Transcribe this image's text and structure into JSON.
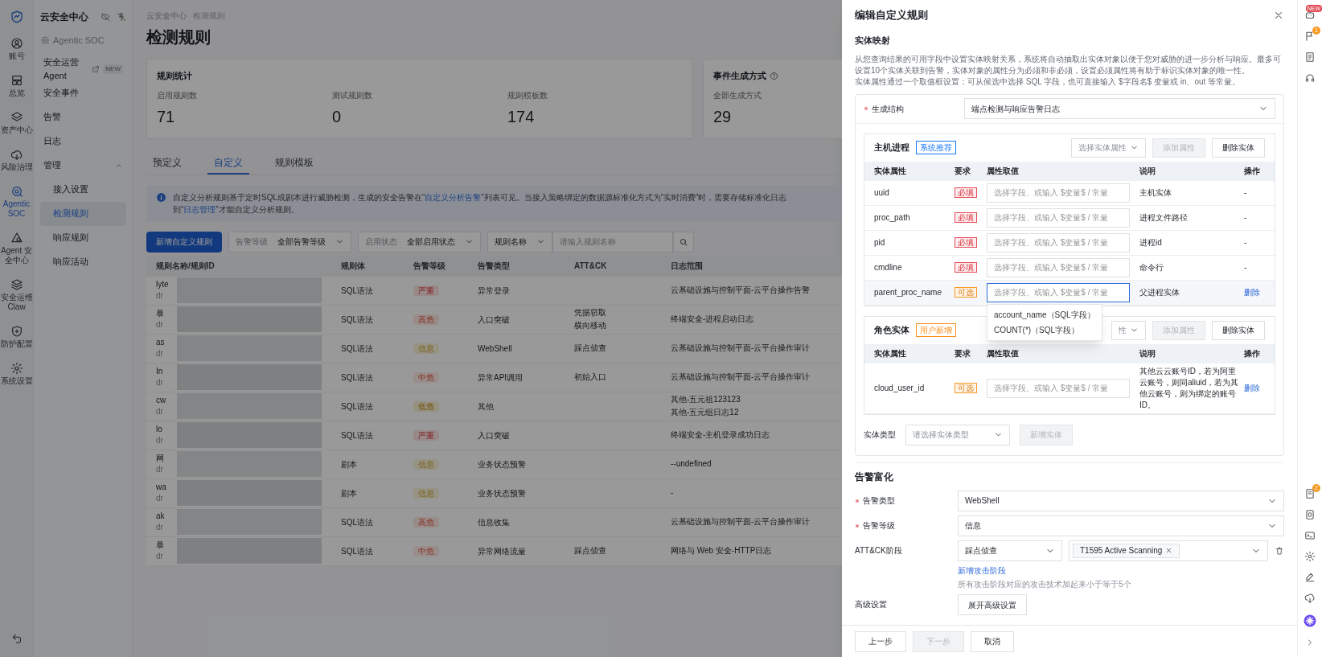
{
  "nav_rail": {
    "items": [
      {
        "label": "账号",
        "selected": false
      },
      {
        "label": "总览",
        "selected": false
      },
      {
        "label": "资产中心",
        "selected": false
      },
      {
        "label": "风险治理",
        "selected": false
      },
      {
        "label": "Agentic SOC",
        "selected": true
      },
      {
        "label": "Agent 安全中心",
        "selected": false
      },
      {
        "label": "安全运维 Claw",
        "selected": false
      },
      {
        "label": "防护配置",
        "selected": false
      },
      {
        "label": "系统设置",
        "selected": false
      }
    ]
  },
  "sidebar": {
    "title": "云安全中心",
    "product": "Agentic SOC",
    "items": [
      {
        "kind": "item",
        "label": "安全运营 Agent",
        "external": true,
        "badge": "NEW",
        "selected": false
      },
      {
        "kind": "item",
        "label": "安全事件",
        "selected": false
      },
      {
        "kind": "item",
        "label": "告警",
        "selected": false
      },
      {
        "kind": "item",
        "label": "日志",
        "selected": false
      },
      {
        "kind": "group",
        "label": "管理",
        "expanded": true,
        "children": [
          {
            "label": "接入设置",
            "selected": false
          },
          {
            "label": "检测规则",
            "selected": true
          },
          {
            "label": "响应规则",
            "selected": false
          },
          {
            "label": "响应活动",
            "selected": false
          }
        ]
      }
    ]
  },
  "main": {
    "breadcrumb": [
      "云安全中心",
      "检测规则"
    ],
    "title": "检测规则",
    "rule_stats": {
      "title": "规则统计",
      "metrics": [
        {
          "label": "启用规则数",
          "value": "71"
        },
        {
          "label": "测试规则数",
          "value": "0"
        },
        {
          "label": "规则模板数",
          "value": "174"
        }
      ]
    },
    "event_stats": {
      "title": "事件生成方式",
      "metrics": [
        {
          "label": "全部生成方式",
          "value": "29"
        }
      ]
    },
    "tabs": [
      {
        "label": "预定义",
        "selected": false
      },
      {
        "label": "自定义",
        "selected": true
      },
      {
        "label": "规则模板",
        "selected": false
      }
    ],
    "notice": [
      {
        "text": "自定义分析规则基于定时SQL或剧本进行威胁检测，生成的安全告警在“",
        "link": false
      },
      {
        "text": "自定义分析告警",
        "link": true
      },
      {
        "text": "”列表可见。当接入策略绑定的数据源标准化方式为“实时消费”时，需要存储标准化日志到“",
        "link": false
      },
      {
        "text": "日志管理",
        "link": true
      },
      {
        "text": "”才能自定义分析规则。",
        "link": false
      }
    ],
    "toolbar": {
      "create_button": "新增自定义规则",
      "filters": [
        {
          "label": "告警等级",
          "value": "全部告警等级"
        },
        {
          "label": "启用状态",
          "value": "全部启用状态"
        }
      ],
      "search": {
        "field": "规则名称",
        "placeholder": "请输入规则名称"
      }
    },
    "table": {
      "columns": [
        "规则名称/规则ID",
        "规则体",
        "告警等级",
        "告警类型",
        "ATT&CK",
        "日志范围"
      ],
      "rows": [
        {
          "name": "lyte",
          "id": "dr",
          "body": "SQL语法",
          "severity": {
            "text": "严重",
            "kind": "critical"
          },
          "type": "异常登录",
          "attack": [],
          "log": [
            "云基础设施与控制平面-云平台操作告警"
          ]
        },
        {
          "name": "暴",
          "id": "dr",
          "body": "SQL语法",
          "severity": {
            "text": "高危",
            "kind": "high"
          },
          "type": "入口突破",
          "attack": [
            "凭据窃取",
            "横向移动"
          ],
          "log": [
            "终端安全-进程启动日志"
          ]
        },
        {
          "name": "as",
          "id": "dr",
          "body": "SQL语法",
          "severity": {
            "text": "信息",
            "kind": "info"
          },
          "type": "WebShell",
          "attack": [
            "踩点侦查"
          ],
          "log": [
            "云基础设施与控制平面-云平台操作审计"
          ]
        },
        {
          "name": "In",
          "id": "dr",
          "body": "SQL语法",
          "severity": {
            "text": "中危",
            "kind": "medium"
          },
          "type": "异常API调用",
          "attack": [
            "初始入口"
          ],
          "log": [
            "云基础设施与控制平面-云平台操作审计"
          ]
        },
        {
          "name": "cw",
          "id": "dr",
          "body": "SQL语法",
          "severity": {
            "text": "低危",
            "kind": "low"
          },
          "type": "其他",
          "attack": [],
          "log": [
            "其他-五元祖123123",
            "其他-五元组日志12"
          ]
        },
        {
          "name": "lo",
          "id": "dr",
          "body": "SQL语法",
          "severity": {
            "text": "严重",
            "kind": "critical"
          },
          "type": "入口突破",
          "attack": [],
          "log": [
            "终端安全-主机登录成功日志"
          ]
        },
        {
          "name": "网",
          "id": "dr",
          "body": "剧本",
          "severity": {
            "text": "信息",
            "kind": "info"
          },
          "type": "业务状态预警",
          "attack": [],
          "log": [
            "--undefined"
          ]
        },
        {
          "name": "wa",
          "id": "dr",
          "body": "剧本",
          "severity": {
            "text": "信息",
            "kind": "info"
          },
          "type": "业务状态预警",
          "attack": [],
          "log": [
            "-"
          ]
        },
        {
          "name": "ak",
          "id": "dr",
          "body": "SQL语法",
          "severity": {
            "text": "高危",
            "kind": "high"
          },
          "type": "信息收集",
          "attack": [],
          "log": [
            "云基础设施与控制平面-云平台操作审计"
          ]
        },
        {
          "name": "暴",
          "id": "dr",
          "body": "SQL语法",
          "severity": {
            "text": "中危",
            "kind": "medium"
          },
          "type": "异常网络流量",
          "attack": [
            "踩点侦查"
          ],
          "log": [
            "网络与 Web 安全-HTTP日志"
          ]
        }
      ]
    }
  },
  "drawer": {
    "title": "编辑自定义规则",
    "entity_mapping": {
      "heading": "实体映射",
      "description": [
        "从您查询结果的可用字段中设置实体映射关系，系统将自动抽取出实体对象以便于您对威胁的进一步分析与响应。最多可设置10个实体关联到告警，实体对象的属性分为必须和非必须，设置必须属性将有助于标识实体对象的唯一性。",
        "实体属性通过一个取值框设置：可从候选中选择 SQL 字段，也可直接输入 $字段名$ 变量或 in、out 等常量。"
      ],
      "structure": {
        "label": "生成结构",
        "required": true,
        "value": "端点检测与响应告警日志"
      },
      "entities": [
        {
          "name": "主机进程",
          "tag": "系统推荐",
          "color": "#1677ff",
          "attr_select": "选择实体属性",
          "add_button": "添加属性",
          "add_disabled": true,
          "delete_button": "删除实体",
          "columns": [
            "实体属性",
            "要求",
            "属性取值",
            "说明",
            "操作"
          ],
          "rows": [
            {
              "attr": "uuid",
              "requirement": "必填",
              "required": true,
              "placeholder": "选择字段、或输入 $变量$ / 常量",
              "focused": false,
              "note": "主机实体",
              "action": {
                "kind": "text",
                "text": "-"
              }
            },
            {
              "attr": "proc_path",
              "requirement": "必填",
              "required": true,
              "placeholder": "选择字段、或输入 $变量$ / 常量",
              "focused": false,
              "note": "进程文件路径",
              "action": {
                "kind": "text",
                "text": "-"
              }
            },
            {
              "attr": "pid",
              "requirement": "必填",
              "required": true,
              "placeholder": "选择字段、或输入 $变量$ / 常量",
              "focused": false,
              "note": "进程id",
              "action": {
                "kind": "text",
                "text": "-"
              }
            },
            {
              "attr": "cmdline",
              "requirement": "必填",
              "required": true,
              "placeholder": "选择字段、或输入 $变量$ / 常量",
              "focused": false,
              "note": "命令行",
              "action": {
                "kind": "text",
                "text": "-"
              }
            },
            {
              "attr": "parent_proc_name",
              "requirement": "可选",
              "required": false,
              "placeholder": "选择字段、或输入 $变量$ / 常量",
              "focused": true,
              "suggestions": [
                "account_name（SQL字段）",
                "COUNT(*)（SQL字段）"
              ],
              "note": "父进程实体",
              "action": {
                "kind": "link",
                "text": "删除"
              }
            }
          ]
        },
        {
          "name": "角色实体",
          "tag": "用户新增",
          "color": "#fa8c16",
          "attr_select": "性",
          "add_button": "添加属性",
          "add_disabled": true,
          "delete_button": "删除实体",
          "columns": [
            "实体属性",
            "要求",
            "属性取值",
            "说明",
            "操作"
          ],
          "rows": [
            {
              "attr": "cloud_user_id",
              "requirement": "可选",
              "required": false,
              "placeholder": "选择字段、或输入 $变量$ / 常量",
              "focused": false,
              "note": "其他云云账号ID，若为阿里云账号，则同aliuid，若为其他云账号，则为绑定的账号ID。",
              "action": {
                "kind": "link",
                "text": "删除"
              }
            }
          ]
        }
      ],
      "entity_type": {
        "label": "实体类型",
        "placeholder": "请选择实体类型",
        "button": "新增实体",
        "button_disabled": true
      }
    },
    "alert_enrichment": {
      "heading": "告警富化",
      "fields": [
        {
          "kind": "select",
          "label": "告警类型",
          "required": true,
          "value": "WebShell"
        },
        {
          "kind": "select",
          "label": "告警等级",
          "required": true,
          "value": "信息"
        },
        {
          "kind": "attack",
          "label": "ATT&CK阶段",
          "stage": "踩点侦查",
          "techniques": [
            "T1595 Active Scanning"
          ],
          "add_link": "新增攻击阶段",
          "hint": "所有攻击阶段对应的攻击技术加起来小于等于5个"
        },
        {
          "kind": "button",
          "label": "高级设置",
          "button": "展开高级设置"
        }
      ]
    },
    "footer": [
      {
        "label": "上一步",
        "disabled": false
      },
      {
        "label": "下一步",
        "disabled": true
      },
      {
        "label": "取消",
        "disabled": false
      }
    ]
  },
  "right_rail": {
    "assistant_badge": "NEW",
    "flag_badge": "1",
    "task_badge": "2"
  }
}
